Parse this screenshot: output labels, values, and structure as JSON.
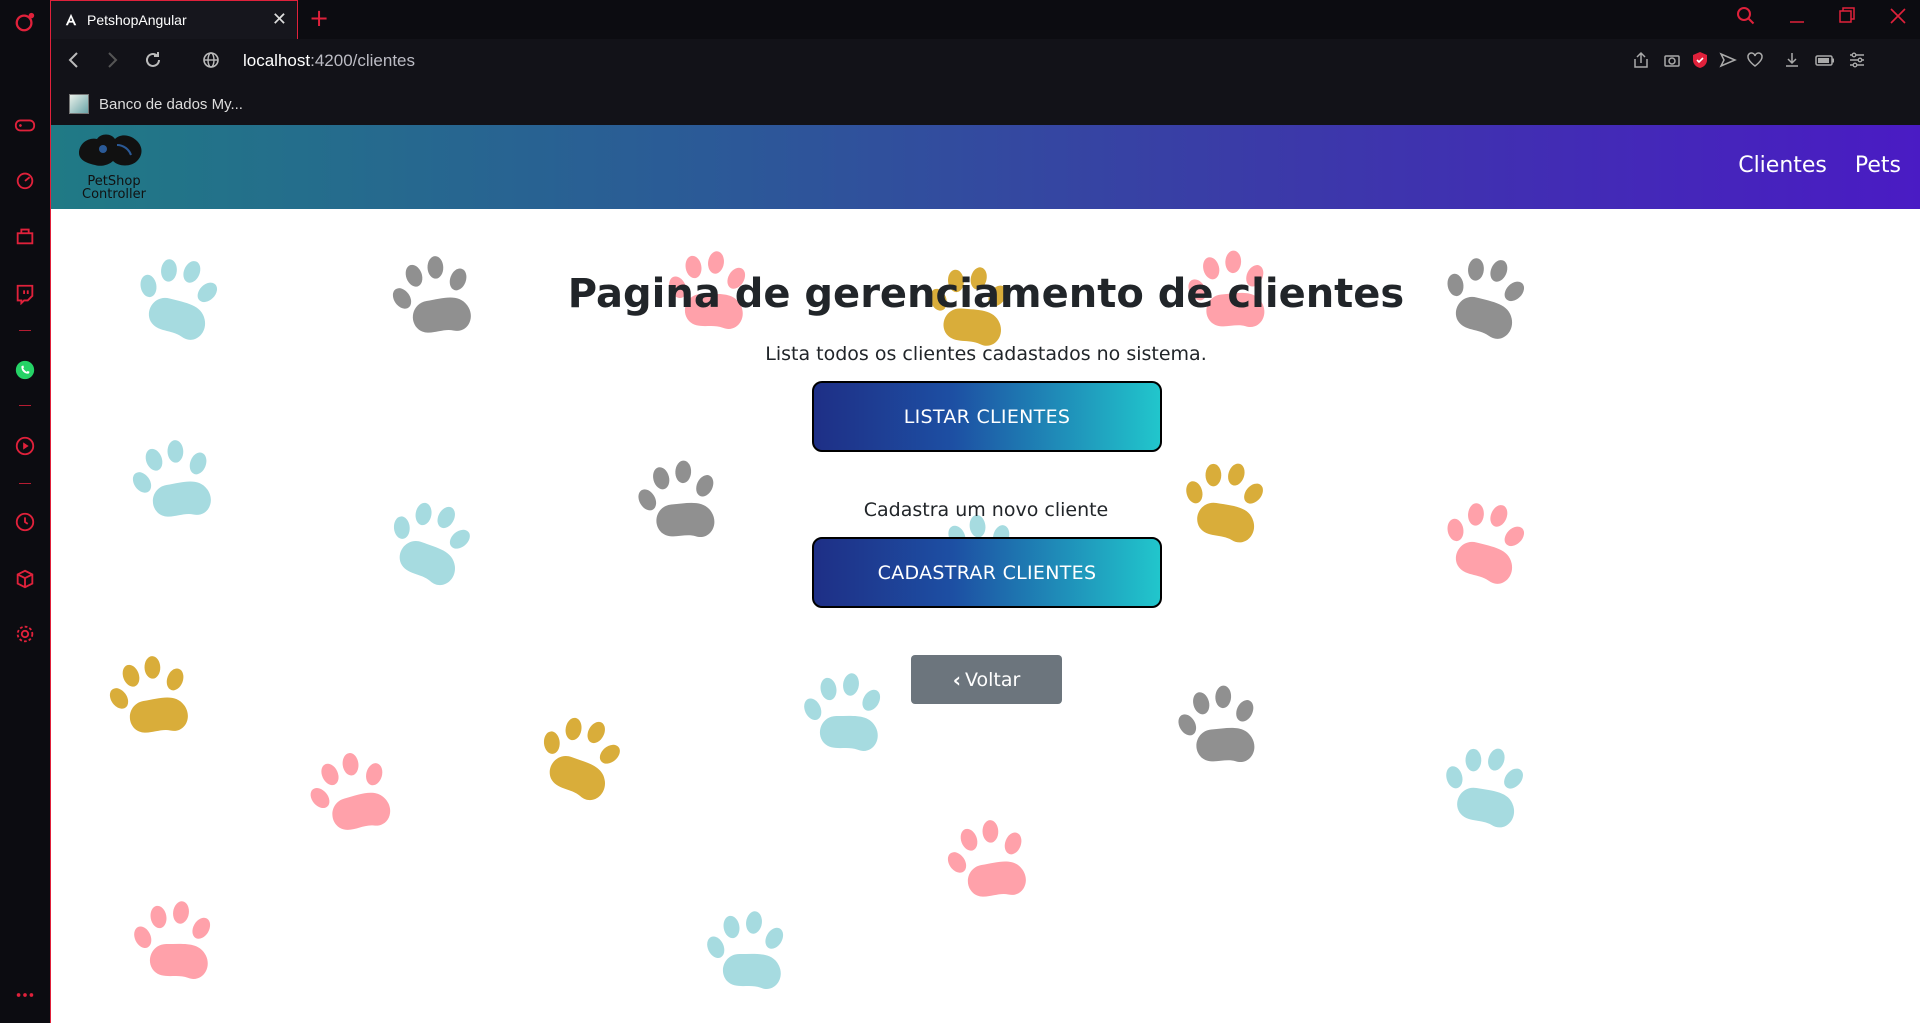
{
  "browser": {
    "tab_title": "PetshopAngular",
    "tab_favicon": "angular-icon",
    "url_host": "localhost",
    "url_path": ":4200/clientes",
    "bookmark": "Banco de dados My...",
    "accent_color": "#e0213b"
  },
  "navbar": {
    "brand_line1": "PetShop",
    "brand_line2": "Controller",
    "links": [
      "Clientes",
      "Pets"
    ],
    "gradient": [
      "#207a85",
      "#4a1bc4"
    ]
  },
  "main": {
    "title": "Pagina de gerenciamento de clientes",
    "list_description": "Lista todos os clientes cadastados no sistema.",
    "list_button": "LISTAR CLIENTES",
    "create_description": "Cadastra um novo cliente",
    "create_button": "CADASTRAR CLIENTES",
    "back_button": "Voltar"
  },
  "paw_colors": {
    "teal": "#a6dbe0",
    "gray": "#909090",
    "pink": "#ffa1aa",
    "gold": "#d9ad3a"
  }
}
